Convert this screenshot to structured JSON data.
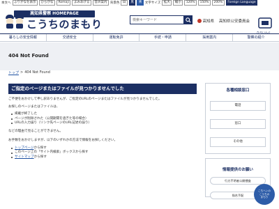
{
  "topbar": {
    "skip": "本文へ",
    "items": [
      "ふりがなを表示",
      "ひらがな",
      "Romaji",
      "よみあげる",
      "音声案内"
    ],
    "contrast_label": "背景色",
    "contrast_options": [
      "白",
      "黒",
      "青"
    ],
    "font_label": "文字サイズ",
    "font_options": [
      "拡大",
      "縮小"
    ],
    "zoom_options": [
      "120%",
      "150%",
      "200%"
    ],
    "language": "Foreign Language"
  },
  "header": {
    "logo_banner": "高知県警察 HOMEPAGE",
    "logo_title": "こうちのまもり",
    "search_placeholder": "検索キーワード",
    "link1": "高知県",
    "link2": "高知県公安委員会",
    "icon_label": "ひろいんぐ"
  },
  "gnav": [
    "暮らしの安全情報",
    "交通安全",
    "運転免許",
    "手続・申請",
    "採用案内",
    "警察の紹介"
  ],
  "page_title": "404 Not Found",
  "breadcrumb": {
    "home": "トップ",
    "sep": ">",
    "current": "404 Not Found"
  },
  "main": {
    "heading": "ご指定のページまたはファイルが見つかりませんでした",
    "intro": "ご不便をおかけして申し訳ありませんが、ご指定のURLのページまたはファイルが見つかりませんでした。",
    "reasons_lead": "お探しのページまたはファイルは、",
    "reasons": [
      "掲載が終了した",
      "ページが削除された（公開期間を過ぎた等の場合）",
      "URLの入力誤り（リンク先ページのURL記述の誤り）"
    ],
    "reasons_tail": "などの理由で見ることができません。",
    "apology": "お手数をおかけしますが、以下のいずれかの方法で情報をお探しください。",
    "options": [
      {
        "link": "トップページ",
        "text": "から探す"
      },
      {
        "link": "",
        "text": "このページ上の「サイト内検索」ボックスから探す"
      },
      {
        "link": "サイトマップ",
        "text": "から探す"
      }
    ]
  },
  "sidebar": {
    "consult_title": "各種相談窓口",
    "buttons": [
      "電話",
      "窓口",
      "その他"
    ],
    "info_title": "情報提供のお願い",
    "pills": [
      "行方不明者公開捜査",
      "指名手配"
    ]
  },
  "float_button": {
    "line1": "こちへンの",
    "line2": "こうちの",
    "line3": "まもり"
  },
  "colors": {
    "navy": "#1c2f63",
    "link": "#1c4fa0",
    "band": "#eef0f4"
  }
}
